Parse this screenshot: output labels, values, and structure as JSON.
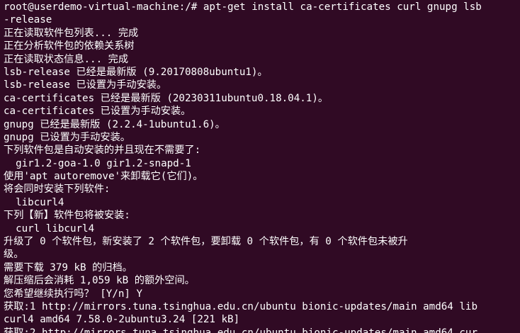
{
  "terminal": {
    "background": "#300a24",
    "foreground": "#ffffff",
    "lines": [
      "root@userdemo-virtual-machine:/# apt-get install ca-certificates curl gnupg lsb",
      "-release",
      "正在读取软件包列表... 完成",
      "正在分析软件包的依赖关系树",
      "正在读取状态信息... 完成",
      "lsb-release 已经是最新版 (9.20170808ubuntu1)。",
      "lsb-release 已设置为手动安装。",
      "ca-certificates 已经是最新版 (20230311ubuntu0.18.04.1)。",
      "ca-certificates 已设置为手动安装。",
      "gnupg 已经是最新版 (2.2.4-1ubuntu1.6)。",
      "gnupg 已设置为手动安装。",
      "下列软件包是自动安装的并且现在不需要了:",
      "  gir1.2-goa-1.0 gir1.2-snapd-1",
      "使用'apt autoremove'来卸载它(它们)。",
      "将会同时安装下列软件:",
      "  libcurl4",
      "下列【新】软件包将被安装:",
      "  curl libcurl4",
      "升级了 0 个软件包，新安装了 2 个软件包，要卸载 0 个软件包，有 0 个软件包未被升",
      "级。",
      "需要下载 379 kB 的归档。",
      "解压缩后会消耗 1,059 kB 的额外空间。",
      "您希望继续执行吗？ [Y/n] Y",
      "获取:1 http://mirrors.tuna.tsinghua.edu.cn/ubuntu bionic-updates/main amd64 lib",
      "curl4 amd64 7.58.0-2ubuntu3.24 [221 kB]",
      "获取:2 http://mirrors.tuna.tsinghua.edu.cn/ubuntu bionic-updates/main amd64 cur"
    ]
  }
}
